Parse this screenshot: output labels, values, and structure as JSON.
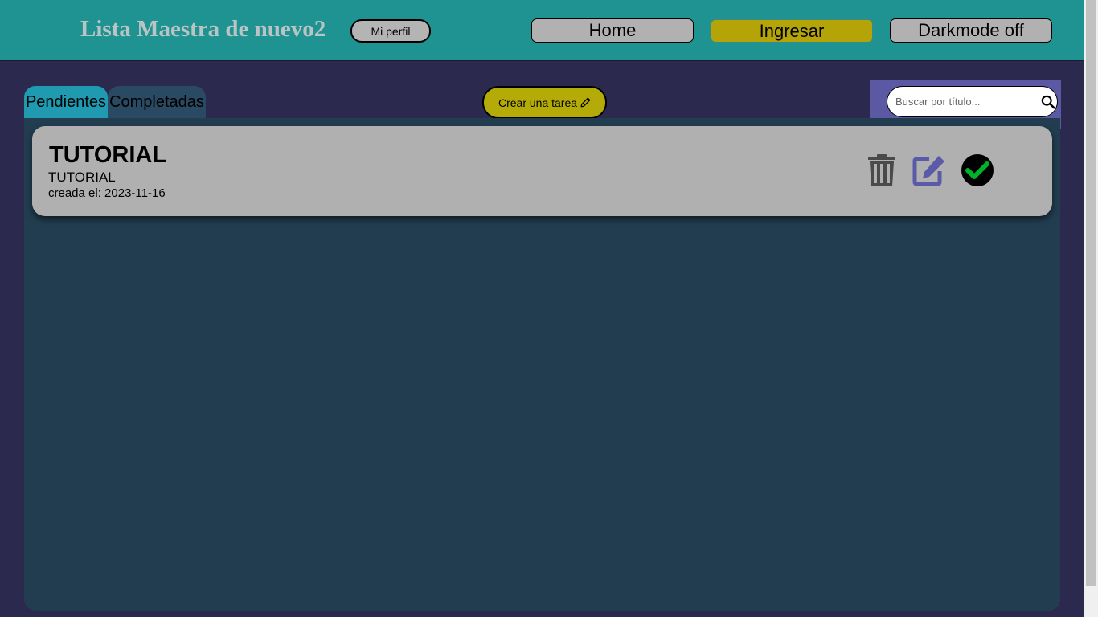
{
  "header": {
    "title": "Lista Maestra de nuevo2",
    "profile_label": "Mi perfil",
    "nav": {
      "home_label": "Home",
      "login_label": "Ingresar",
      "darkmode_label": "Darkmode off"
    }
  },
  "tabs": {
    "pending_label": "Pendientes",
    "completed_label": "Completadas"
  },
  "create_task_label": "Crear una tarea",
  "search": {
    "placeholder": "Buscar por título..."
  },
  "tasks": [
    {
      "title": "TUTORIAL",
      "description": "TUTORIAL",
      "created": "creada el: 2023-11-16"
    }
  ],
  "icons": [
    "pencil-icon",
    "search-icon",
    "trash-icon",
    "edit-icon",
    "check-icon"
  ],
  "colors": {
    "header_bg": "#1f9391",
    "page_bg": "#2b2a4e",
    "panel_bg": "#223d50",
    "accent_yellow": "#b4ab08",
    "pending_tab": "#1f9ab0",
    "search_bg": "#5c59a4",
    "check_green": "#00b22a",
    "edit_purple": "#5b5aa8"
  }
}
